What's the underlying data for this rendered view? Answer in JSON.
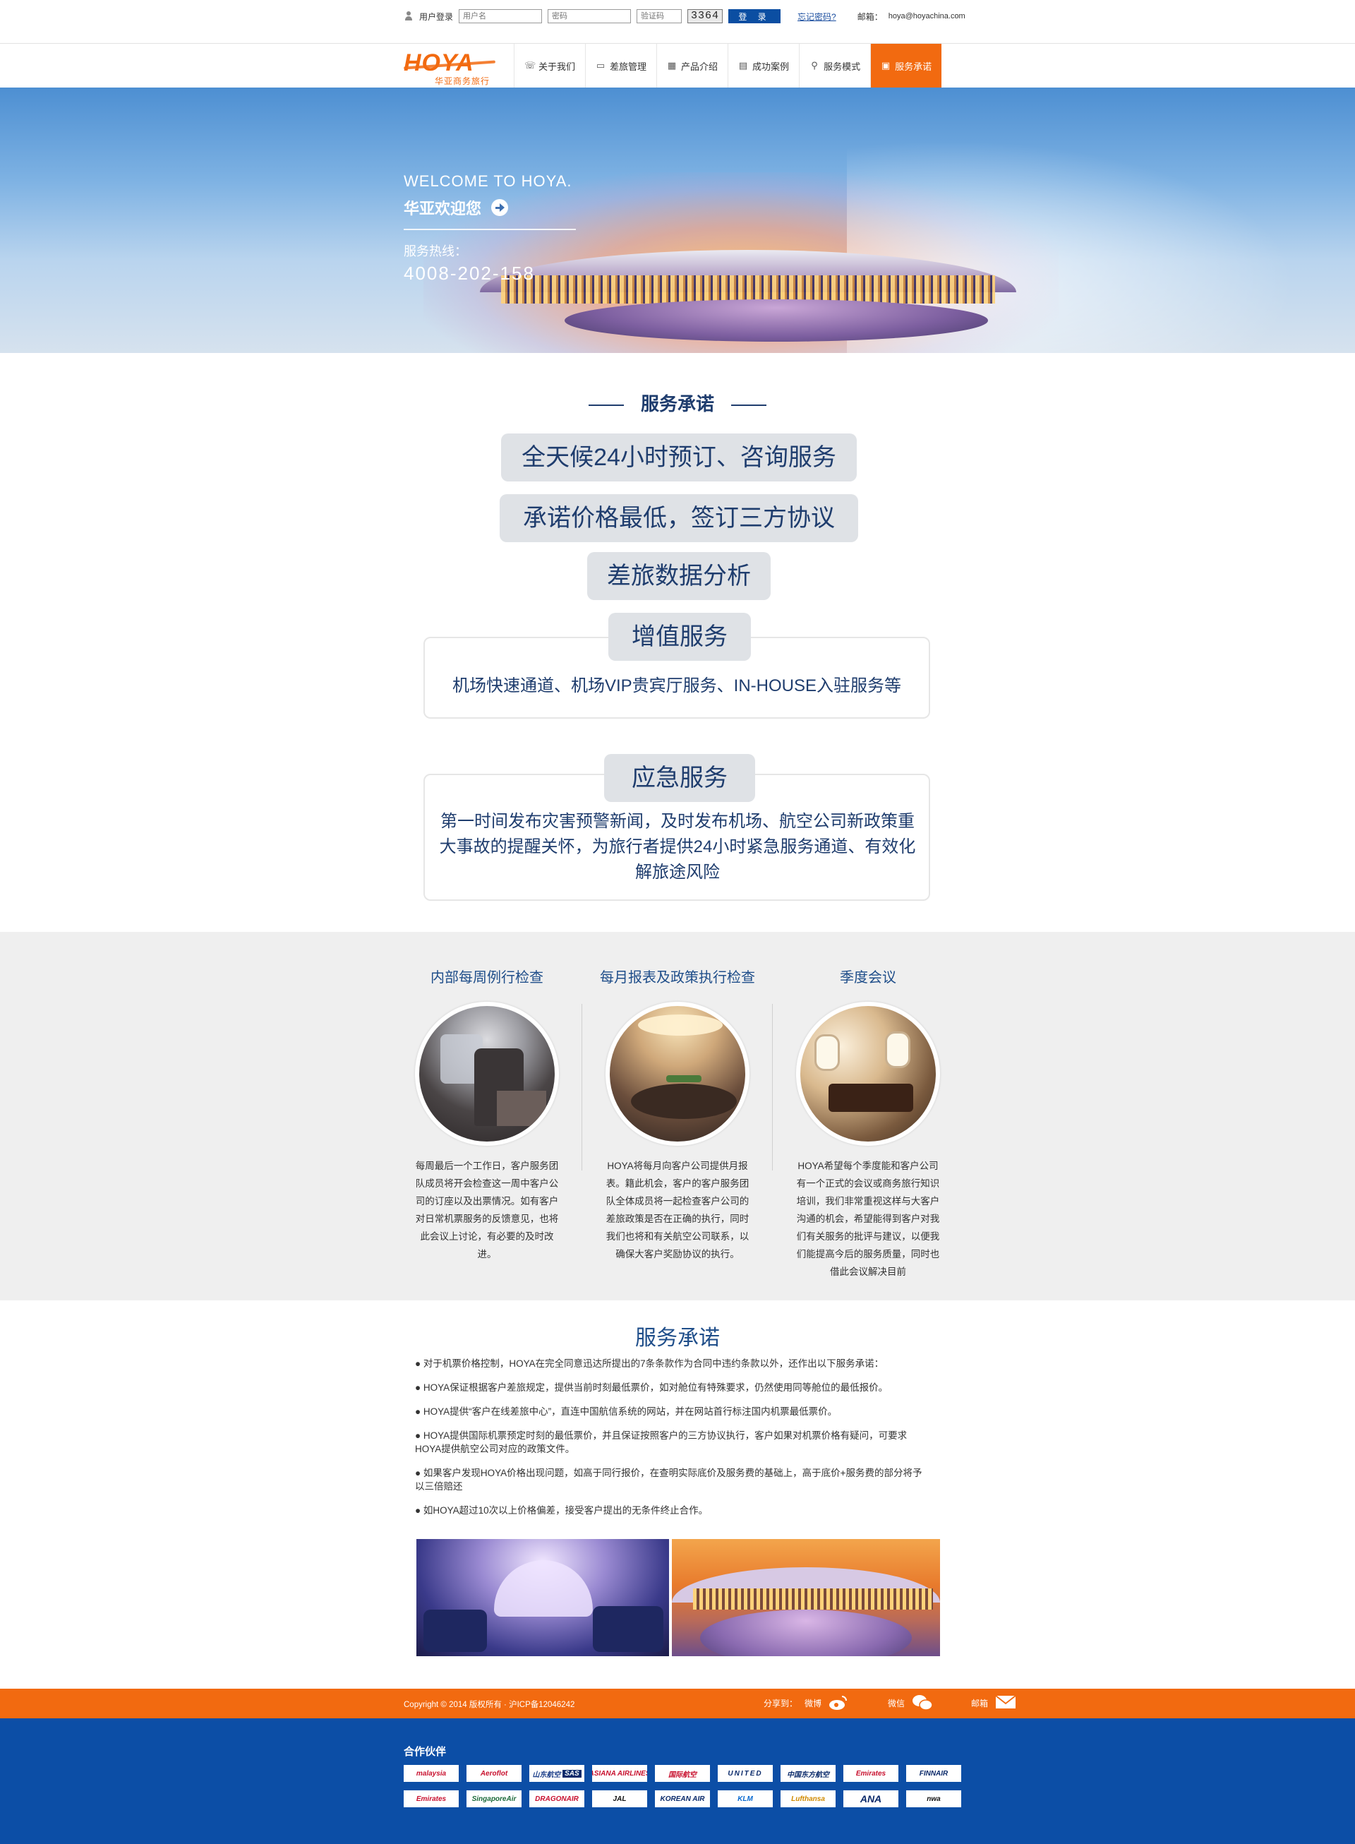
{
  "topbar": {
    "login_label": "用户登录",
    "username_placeholder": "用户名",
    "password_placeholder": "密码",
    "captcha_placeholder": "验证码",
    "captcha_text": "3364",
    "login_button": "登 录",
    "forgot": "忘记密码?",
    "mail_label": "邮箱：",
    "mail_value": "hoya@hoyachina.com"
  },
  "brand": {
    "logo_text": "HOYA",
    "logo_sub": "华亚商务旅行"
  },
  "nav": {
    "items": [
      {
        "label": "关于我们",
        "icon": "phone-icon"
      },
      {
        "label": "差旅管理",
        "icon": "monitor-icon"
      },
      {
        "label": "产品介绍",
        "icon": "grid-icon"
      },
      {
        "label": "成功案例",
        "icon": "document-icon"
      },
      {
        "label": "服务模式",
        "icon": "link-icon"
      },
      {
        "label": "服务承诺",
        "icon": "calendar-icon",
        "active": true
      }
    ]
  },
  "hero": {
    "welcome": "WELCOME TO HOYA.",
    "welcome_cn": "华亚欢迎您",
    "hotline_label": "服务热线：",
    "hotline": "4008-202-158"
  },
  "promise": {
    "title": "服务承诺",
    "pills": [
      "全天候24小时预订、咨询服务",
      "承诺价格最低，签订三方协议",
      "差旅数据分析"
    ],
    "value_added_title": "增值服务",
    "value_added_desc": "机场快速通道、机场VIP贵宾厅服务、IN-HOUSE入驻服务等",
    "emergency_title": "应急服务",
    "emergency_desc": "第一时间发布灾害预警新闻，及时发布机场、航空公司新政策重大事故的提醒关怀，为旅行者提供24小时紧急服务通道、有效化解旅途风险"
  },
  "checks": [
    {
      "title": "内部每周例行检查",
      "text": "每周最后一个工作日，客户服务团队成员将开会检查这一周中客户公司的订座以及出票情况。如有客户对日常机票服务的反馈意见，也将此会议上讨论，有必要的及时改进。"
    },
    {
      "title": "每月报表及政策执行检查",
      "text": "HOYA将每月向客户公司提供月报表。籍此机会，客户的客户服务团队全体成员将一起检查客户公司的差旅政策是否在正确的执行，同时我们也将和有关航空公司联系，以确保大客户奖励协议的执行。"
    },
    {
      "title": "季度会议",
      "text": "HOYA希望每个季度能和客户公司有一个正式的会议或商务旅行知识培训，我们非常重视这样与大客户沟通的机会，希望能得到客户对我们有关服务的批评与建议，以便我们能提高今后的服务质量，同时也借此会议解决目前"
    }
  ],
  "commitments": {
    "title": "服务承诺",
    "items": [
      "对于机票价格控制，HOYA在完全同意迅达所提出的7条条款作为合同中违约条款以外，还作出以下服务承诺：",
      "HOYA保证根据客户差旅规定，提供当前时刻最低票价，如对舱位有特殊要求，仍然使用同等舱位的最低报价。",
      "HOYA提供“客户在线差旅中心”，直连中国航信系统的网站，并在网站首行标注国内机票最低票价。",
      "HOYA提供国际机票预定时刻的最低票价，并且保证按照客户的三方协议执行，客户如果对机票价格有疑问，可要求HOYA提供航空公司对应的政策文件。",
      "如果客户发现HOYA价格出现问题，如高于同行报价，在查明实际底价及服务费的基础上，高于底价+服务费的部分将予以三倍赔还",
      "如HOYA超过10次以上价格偏差，接受客户提出的无条件终止合作。"
    ]
  },
  "footer": {
    "copyright": "Copyright © 2014 版权所有 · 沪ICP备12046242",
    "share_label": "分享到：",
    "weibo": "微博",
    "wechat": "微信",
    "mail": "邮箱",
    "partners_title": "合作伙伴",
    "partners": [
      "malaysia",
      "Aeroflot",
      "山东航空",
      "SAS",
      "ASIANA AIRLINES",
      "国际航空",
      "UNITED",
      "中国东方航空",
      "Emirates",
      "FINNAIR",
      "Emirates",
      "SingaporeAir",
      "DRAGONAIR",
      "JAL",
      "KOREAN AIR",
      "KLM",
      "Lufthansa",
      "ANA",
      "nwa"
    ]
  },
  "colors": {
    "accent": "#f26a10",
    "navy": "#1f3d6e",
    "footer_blue": "#0c4ea6"
  }
}
